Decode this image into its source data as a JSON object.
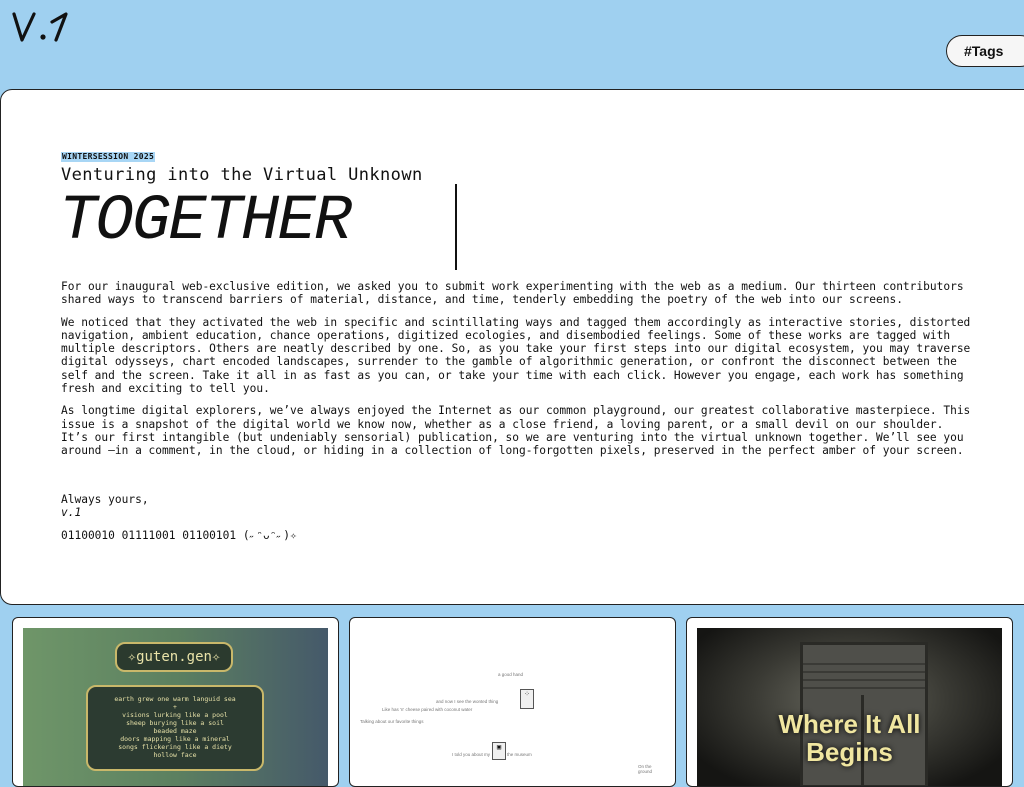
{
  "header": {
    "logo": "v.1",
    "tags_button": "#Tags"
  },
  "intro": {
    "eyebrow": "WINTERSESSION 2025",
    "subtitle": "Venturing into the Virtual Unknown",
    "title": "TOGETHER",
    "paragraphs": [
      "For our inaugural web-exclusive edition, we asked you to submit work experimenting with the web as a medium. Our thirteen contributors shared ways to transcend barriers of material, distance, and time, tenderly embedding the poetry of the web into our screens.",
      "We noticed that they activated the web in specific and scintillating ways and tagged them accordingly as interactive stories, distorted navigation, ambient education, chance operations, digitized ecologies, and disembodied feelings. Some of these works are tagged with multiple descriptors. Others are neatly described by one. So, as you take your first steps into our digital ecosystem, you may traverse digital odysseys, chart encoded landscapes, surrender to the gamble of algorithmic generation, or confront the disconnect between the self and the screen. Take it all in as fast as you can, or take your time with each click. However you engage, each work has something fresh and exciting to tell you.",
      "As longtime digital explorers, we’ve always enjoyed the Internet as our common playground, our greatest collaborative masterpiece. This issue is a snapshot of the digital world we know now, whether as a close friend, a loving parent, or a small devil on our shoulder. It’s our first intangible (but undeniably sensorial) publication, so we are venturing into the virtual unknown together. We’ll see you around —in a comment, in the cloud, or hiding in a collection of long-forgotten pixels, preserved in the perfect amber of your screen."
    ],
    "signoff": "Always yours,",
    "signature": "v.1",
    "binary": "01100010 01111001 01100101 (˶ᵔᴗᵔ˶)✧"
  },
  "works": [
    {
      "title": "✧guten.gen✧",
      "poem": [
        "earth grew one warm languid sea",
        "+",
        "visions lurking like a pool",
        "sheep burying like a soil",
        "beaded maze",
        "doors mapping like a mineral",
        "songs flickering like a diety",
        "hollow face"
      ]
    },
    {
      "snippets": [
        "a good hand",
        "and now I see the wonted thing",
        "Like has 'n' cheese paired with coconut water",
        "Talking about our favorite things",
        "I told you about my",
        "the museum",
        "On the ground"
      ]
    },
    {
      "title_line1": "Where It All",
      "title_line2": "Begins"
    }
  ],
  "colors": {
    "background": "#9fd0f0",
    "highlight": "#a8d6f5",
    "gold": "#e8e2a8"
  }
}
